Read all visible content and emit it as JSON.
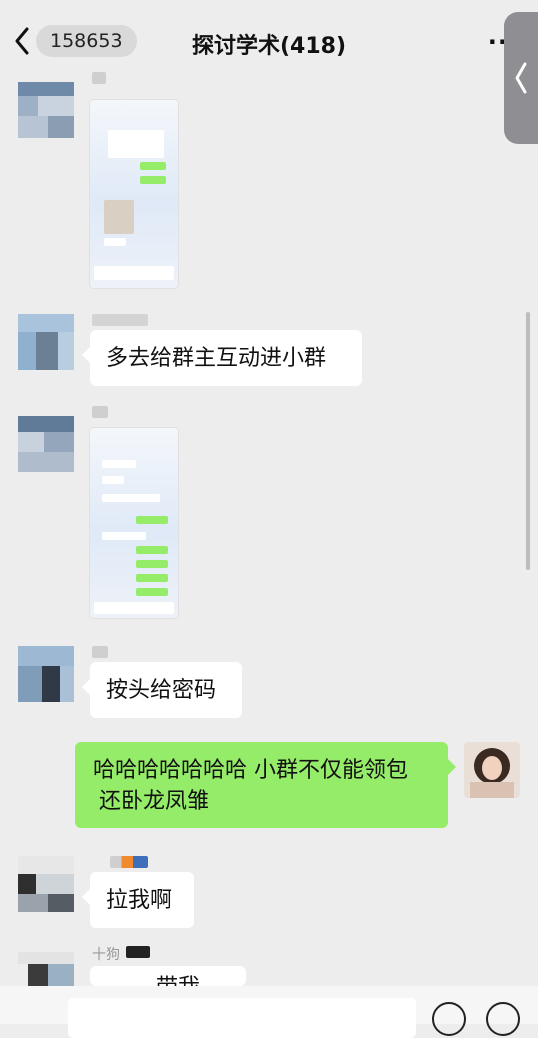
{
  "header": {
    "unread_count": "158653",
    "title": "探讨学术(418)",
    "more_label": "··"
  },
  "messages": [
    {
      "id": 1,
      "type": "image",
      "side": "left"
    },
    {
      "id": 2,
      "type": "text",
      "side": "left",
      "text": "多去给群主互动进小群"
    },
    {
      "id": 3,
      "type": "image",
      "side": "left"
    },
    {
      "id": 4,
      "type": "text",
      "side": "left",
      "text": "按头给密码"
    },
    {
      "id": 5,
      "type": "text",
      "side": "right",
      "line1": "哈哈哈哈哈哈哈 小群不仅能领包",
      "line2": "还卧龙凤雏"
    },
    {
      "id": 6,
      "type": "text",
      "side": "left",
      "text": "拉我啊"
    },
    {
      "id": 7,
      "type": "text",
      "side": "left",
      "nickname": "十狗",
      "text": "带我"
    }
  ],
  "colors": {
    "background": "#ededed",
    "self_bubble": "#95ec69",
    "other_bubble": "#ffffff",
    "nickname": "#999999"
  },
  "icons": [
    "back-chevron-icon",
    "more-icon",
    "side-panel-chevron-icon",
    "emoji-icon",
    "plus-icon"
  ]
}
